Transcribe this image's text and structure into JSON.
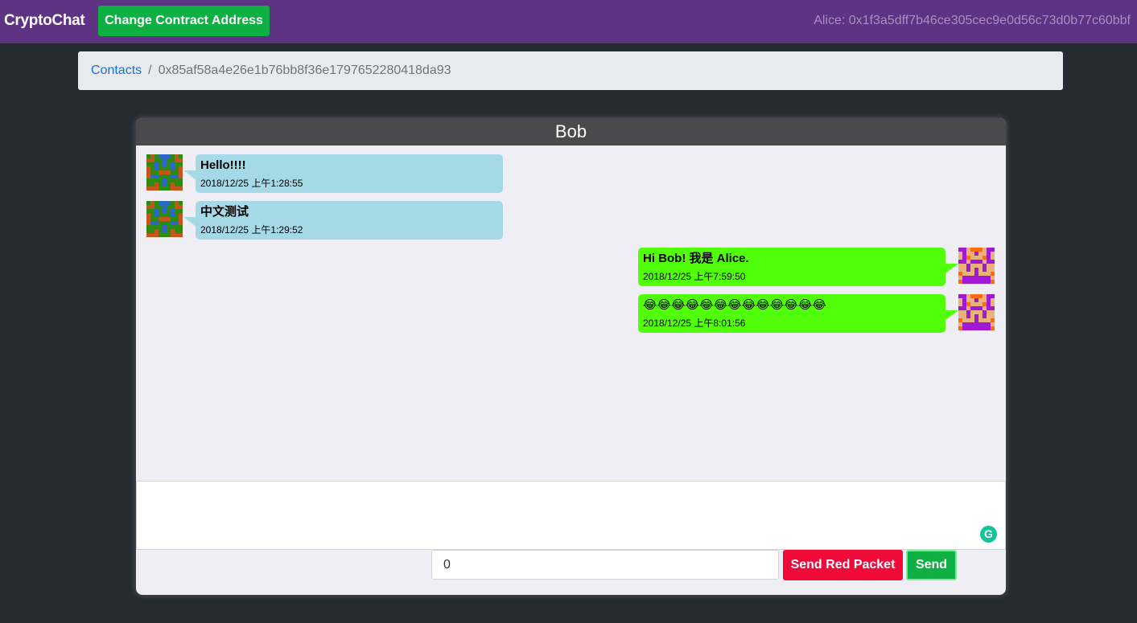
{
  "navbar": {
    "brand": "CryptoChat",
    "change_contract_label": "Change Contract Address",
    "account": "Alice: 0x1f3a5dff7b46ce305cec9e0d56c73d0b77c60bbf"
  },
  "breadcrumb": {
    "link": "Contacts",
    "separator": "/",
    "current": "0x85af58a4e26e1b76bb8f36e1797652280418da93"
  },
  "chat": {
    "title": "Bob",
    "messages": [
      {
        "direction": "incoming",
        "text": "Hello!!!!",
        "time": "2018/12/25 上午1:28:55"
      },
      {
        "direction": "incoming",
        "text": "中文测试",
        "time": "2018/12/25 上午1:29:52"
      },
      {
        "direction": "outgoing",
        "text": "Hi Bob! 我是 Alice.",
        "time": "2018/12/25 上午7:59:50"
      },
      {
        "direction": "outgoing",
        "text": "😂😂😂😂😂😂😂😂😂😂😂😂😂",
        "time": "2018/12/25 上午8:01:56"
      }
    ],
    "compose_value": "",
    "amount_value": "0",
    "red_packet_label": "Send Red Packet",
    "send_label": "Send"
  },
  "colors": {
    "navbar": "#5f3383",
    "incoming_bubble": "#a6d9e6",
    "outgoing_bubble": "#52ff0a",
    "primary_green": "#0fb043",
    "red_packet": "#ef0a3a",
    "background": "#262a31"
  },
  "icons": {
    "grammarly": "grammarly-icon",
    "bob_avatar": "identicon-green",
    "alice_avatar": "identicon-purple"
  }
}
